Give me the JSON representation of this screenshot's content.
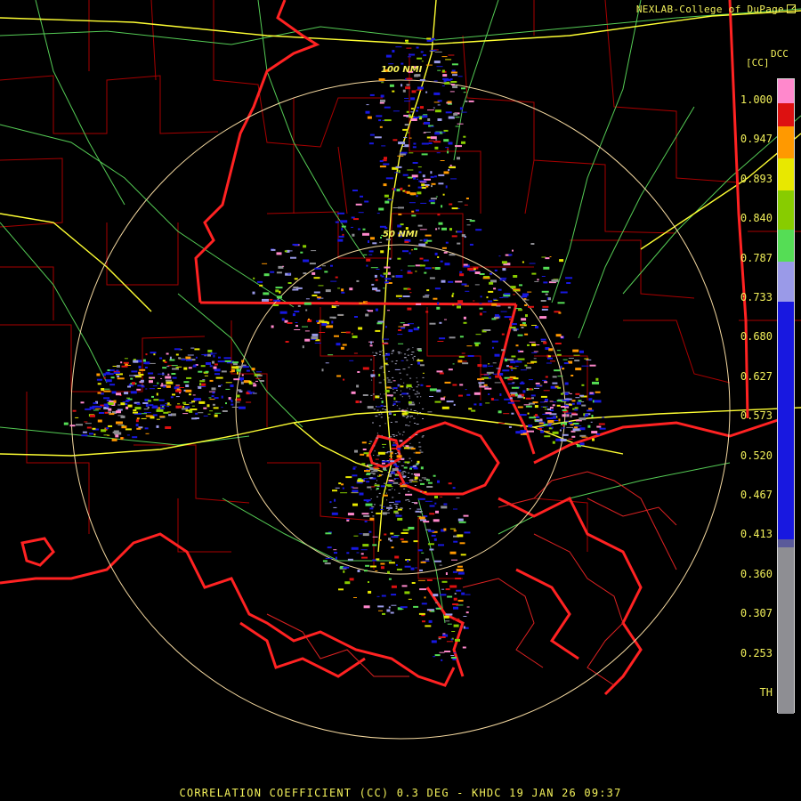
{
  "header": {
    "credit": "NEXLAB-College of DuPage",
    "credit_icon": "external-link-icon"
  },
  "legend": {
    "product_code": "DCC",
    "units": "[CC]",
    "ticks": [
      "1.000",
      "0.947",
      "0.893",
      "0.840",
      "0.787",
      "0.733",
      "0.680",
      "0.627",
      "0.573",
      "0.520",
      "0.467",
      "0.413",
      "0.360",
      "0.307",
      "0.253",
      "TH"
    ],
    "tick_values": [
      1.0,
      0.947,
      0.893,
      0.84,
      0.787,
      0.733,
      0.68,
      0.627,
      0.573,
      0.52,
      0.467,
      0.413,
      0.36,
      0.307,
      0.253,
      0.2
    ],
    "color_stops": [
      {
        "from": 0.2,
        "to": 0.41,
        "color": "#8e8e93"
      },
      {
        "from": 0.41,
        "to": 0.42,
        "color": "#5a5a9a"
      },
      {
        "from": 0.42,
        "to": 0.72,
        "color": "#1818e0"
      },
      {
        "from": 0.72,
        "to": 0.77,
        "color": "#9a9ae8"
      },
      {
        "from": 0.77,
        "to": 0.81,
        "color": "#55dd55"
      },
      {
        "from": 0.81,
        "to": 0.86,
        "color": "#88cc00"
      },
      {
        "from": 0.86,
        "to": 0.9,
        "color": "#e8e800"
      },
      {
        "from": 0.9,
        "to": 0.94,
        "color": "#ff9900"
      },
      {
        "from": 0.94,
        "to": 0.97,
        "color": "#dd1111"
      },
      {
        "from": 0.97,
        "to": 1.0,
        "color": "#ff88cc"
      }
    ]
  },
  "map": {
    "range_rings": [
      {
        "label": "100 NMI",
        "nmi": 100
      },
      {
        "label": "50 NMI",
        "nmi": 50
      }
    ],
    "colors": {
      "state_border": "#ff2222",
      "county_border": "#bb0000",
      "interstate": "#ffff33",
      "highway": "#66dd66",
      "range_ring": "#f5d9a0"
    }
  },
  "footer": {
    "caption": "CORRELATION COEFFICIENT (CC) 0.3 DEG - KHDC 19 JAN 26 09:37"
  }
}
